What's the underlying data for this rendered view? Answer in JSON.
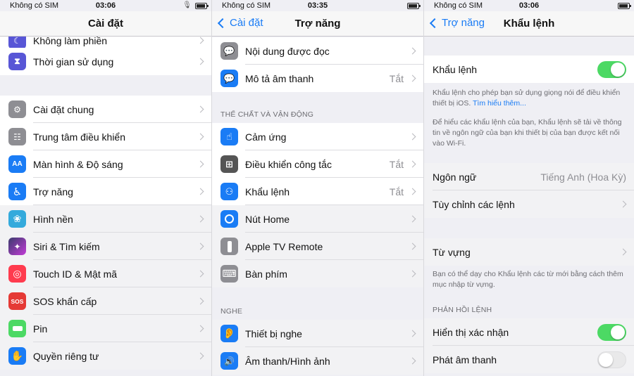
{
  "panel1": {
    "status": {
      "carrier": "Không có SIM",
      "time": "03:06"
    },
    "title": "Cài đặt",
    "partial_item": "Không làm phiền",
    "items": [
      {
        "label": "Thời gian sử dụng",
        "icon": "hourglass-icon",
        "color": "#5856d6"
      },
      {
        "label": "Cài đặt chung",
        "icon": "gear-icon",
        "color": "#8e8e93"
      },
      {
        "label": "Trung tâm điều khiển",
        "icon": "control-center-icon",
        "color": "#8e8e93"
      },
      {
        "label": "Màn hình & Độ sáng",
        "icon": "display-brightness-icon",
        "color": "#1a7cf5",
        "glyph": "AA"
      },
      {
        "label": "Trợ năng",
        "icon": "accessibility-icon",
        "color": "#1a7cf5"
      },
      {
        "label": "Hình nền",
        "icon": "wallpaper-icon",
        "color": "#34aadc"
      },
      {
        "label": "Siri & Tìm kiếm",
        "icon": "siri-icon",
        "color": "#3b3b6d"
      },
      {
        "label": "Touch ID & Mật mã",
        "icon": "fingerprint-icon",
        "color": "#ff3b4e"
      },
      {
        "label": "SOS khẩn cấp",
        "icon": "sos-icon",
        "color": "#e53935",
        "glyph": "SOS"
      },
      {
        "label": "Pin",
        "icon": "battery-icon",
        "color": "#4cd964"
      },
      {
        "label": "Quyền riêng tư",
        "icon": "privacy-hand-icon",
        "color": "#1a7cf5"
      }
    ]
  },
  "panel2": {
    "status": {
      "carrier": "Không có SIM",
      "time": "03:35"
    },
    "back": "Cài đặt",
    "title": "Trợ năng",
    "items_top": [
      {
        "label": "Nội dung được đọc",
        "icon": "spoken-content-icon",
        "color": "#8e8e93",
        "value": ""
      },
      {
        "label": "Mô tả âm thanh",
        "icon": "audio-description-icon",
        "color": "#1a7cf5",
        "value": "Tắt"
      }
    ],
    "section_physical": "THỂ CHẤT VÀ VẬN ĐỘNG",
    "items_physical": [
      {
        "label": "Cảm ứng",
        "icon": "touch-icon",
        "color": "#1a7cf5",
        "value": ""
      },
      {
        "label": "Điều khiển công tắc",
        "icon": "switch-control-icon",
        "color": "#555555",
        "value": "Tắt"
      },
      {
        "label": "Khẩu lệnh",
        "icon": "voice-control-icon",
        "color": "#1a7cf5",
        "value": "Tắt"
      },
      {
        "label": "Nút Home",
        "icon": "home-button-icon",
        "color": "#1a7cf5",
        "value": ""
      },
      {
        "label": "Apple TV Remote",
        "icon": "remote-icon",
        "color": "#8e8e93",
        "value": ""
      },
      {
        "label": "Bàn phím",
        "icon": "keyboard-icon",
        "color": "#8e8e93",
        "value": ""
      }
    ],
    "section_hearing": "NGHE",
    "items_hearing": [
      {
        "label": "Thiết bị nghe",
        "icon": "hearing-device-icon",
        "color": "#1a7cf5",
        "value": ""
      },
      {
        "label": "Âm thanh/Hình ảnh",
        "icon": "audio-visual-icon",
        "color": "#1a7cf5",
        "value": ""
      }
    ]
  },
  "panel3": {
    "status": {
      "carrier": "Không có SIM",
      "time": "03:06"
    },
    "back": "Trợ năng",
    "title": "Khẩu lệnh",
    "voice_control": {
      "label": "Khẩu lệnh",
      "on": true
    },
    "desc1": "Khẩu lệnh cho phép bạn sử dụng giọng nói để điều khiển thiết bị iOS.",
    "learn_more": "Tìm hiểu thêm...",
    "desc2": "Để hiểu các khẩu lệnh của bạn, Khẩu lệnh sẽ tải về thông tin về ngôn ngữ của bạn khi thiết bị của bạn được kết nối vào Wi-Fi.",
    "language": {
      "label": "Ngôn ngữ",
      "value": "Tiếng Anh (Hoa Kỳ)"
    },
    "customize": {
      "label": "Tùy chỉnh các lệnh"
    },
    "vocabulary": {
      "label": "Từ vựng"
    },
    "vocab_desc": "Bạn có thể dạy cho Khẩu lệnh các từ mới bằng cách thêm mục nhập từ vựng.",
    "section_feedback": "PHẢN HỒI LỆNH",
    "show_confirm": {
      "label": "Hiển thị xác nhận",
      "on": true
    },
    "play_sound": {
      "label": "Phát âm thanh",
      "on": false
    }
  },
  "colors": {
    "accent": "#1a7cf5",
    "toggle_on": "#4cd964",
    "background": "#efeff4"
  }
}
